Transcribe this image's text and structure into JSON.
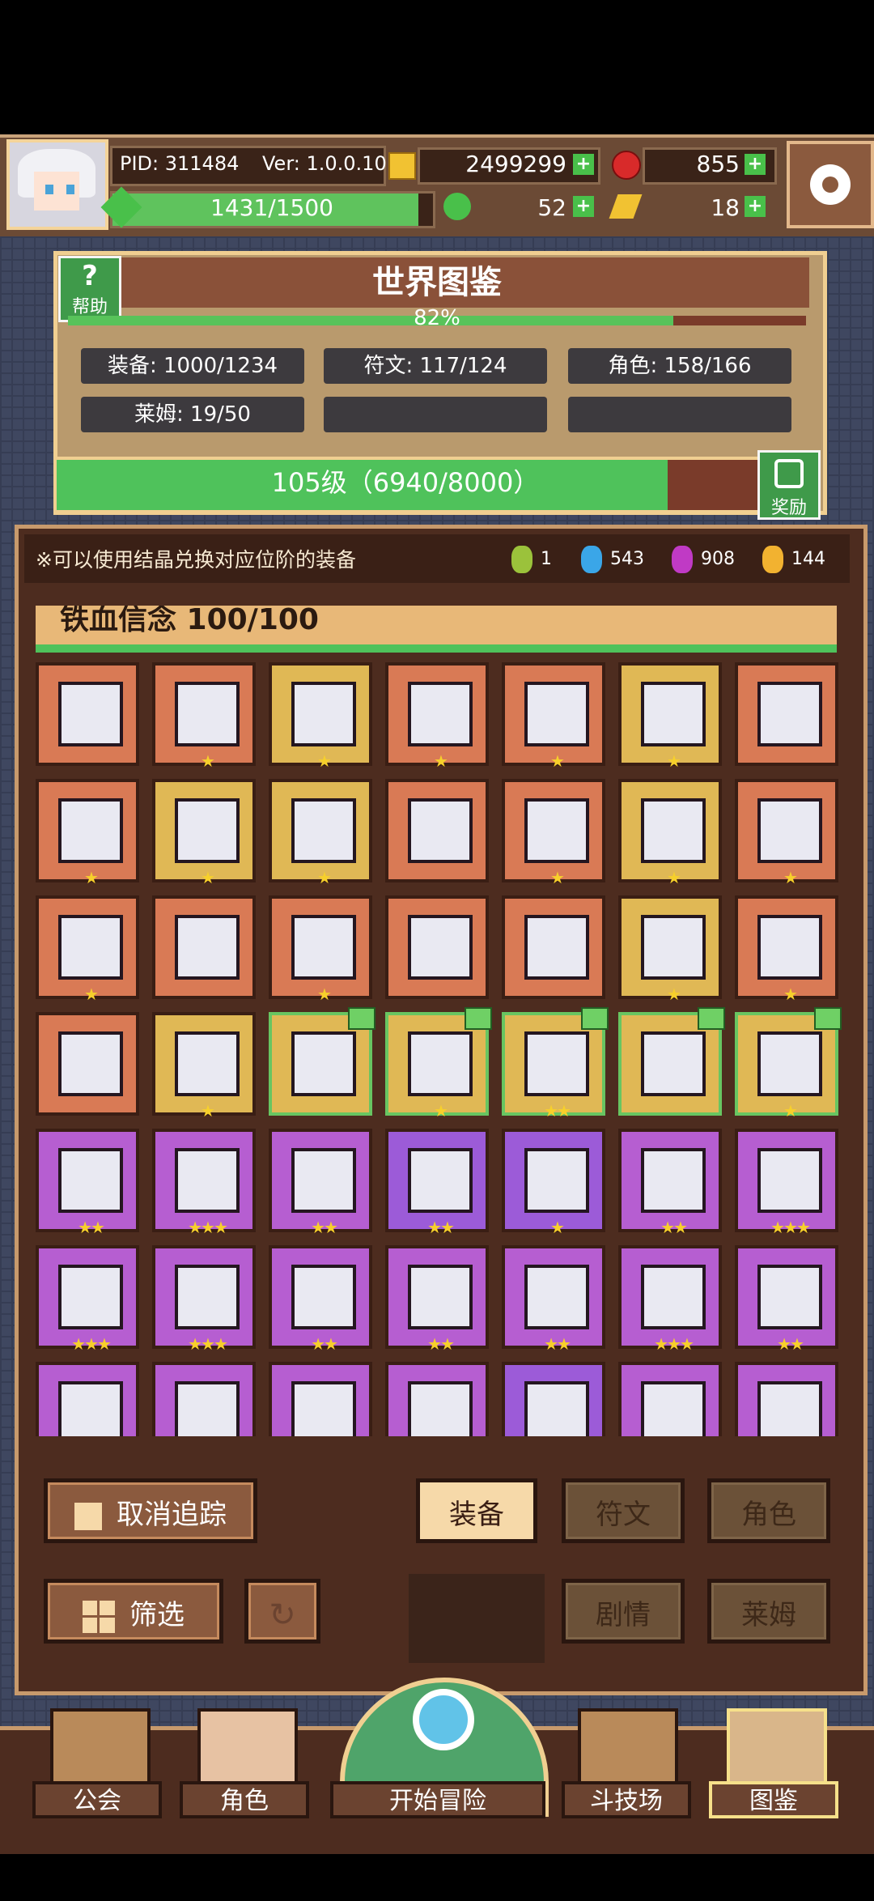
{
  "header": {
    "pid": "PID: 311484",
    "version": "Ver: 1.0.0.10",
    "gold": "2499299",
    "ruby": "855",
    "energy": "1431/1500",
    "energy_fraction": 0.954,
    "clover": "52",
    "ticket": "18"
  },
  "codex": {
    "title": "世界图鉴",
    "help_label": "帮助",
    "progress_text": "82%",
    "progress_fraction": 0.82,
    "stats": {
      "equipment": "装备: 1000/1234",
      "rune": "符文: 117/124",
      "character": "角色: 158/166",
      "slime": "莱姆: 19/50"
    },
    "level_text": "105级（6940/8000）",
    "level_fraction": 0.8675,
    "reward_label": "奖励"
  },
  "main": {
    "note": "※可以使用结晶兑换对应位阶的装备",
    "crystals": [
      {
        "color": "#9bc23b",
        "count": "1"
      },
      {
        "color": "#3aa6e8",
        "count": "543"
      },
      {
        "color": "#c03ac5",
        "count": "908"
      },
      {
        "color": "#f2b230",
        "count": "144"
      }
    ],
    "set_title": "铁血信念  100/100",
    "grid_rows": [
      [
        {
          "bg": "red",
          "stars": 0
        },
        {
          "bg": "red",
          "stars": 1
        },
        {
          "bg": "gold",
          "stars": 1
        },
        {
          "bg": "red",
          "stars": 1
        },
        {
          "bg": "red",
          "stars": 1
        },
        {
          "bg": "gold",
          "stars": 1
        },
        {
          "bg": "red",
          "stars": 0
        }
      ],
      [
        {
          "bg": "red",
          "stars": 1
        },
        {
          "bg": "gold",
          "stars": 1
        },
        {
          "bg": "gold",
          "stars": 1
        },
        {
          "bg": "red",
          "stars": 0
        },
        {
          "bg": "red",
          "stars": 1
        },
        {
          "bg": "gold",
          "stars": 1
        },
        {
          "bg": "red",
          "stars": 1
        }
      ],
      [
        {
          "bg": "red",
          "stars": 1
        },
        {
          "bg": "red",
          "stars": 0
        },
        {
          "bg": "red",
          "stars": 1
        },
        {
          "bg": "red",
          "stars": 0
        },
        {
          "bg": "red",
          "stars": 0
        },
        {
          "bg": "gold",
          "stars": 1
        },
        {
          "bg": "red",
          "stars": 1
        }
      ],
      [
        {
          "bg": "red",
          "stars": 0
        },
        {
          "bg": "gold",
          "stars": 1
        },
        {
          "bg": "gold",
          "stars": 0,
          "new": true
        },
        {
          "bg": "gold",
          "stars": 1,
          "new": true
        },
        {
          "bg": "gold",
          "stars": 2,
          "new": true
        },
        {
          "bg": "gold",
          "stars": 0,
          "new": true
        },
        {
          "bg": "gold",
          "stars": 1,
          "new": true
        }
      ],
      [
        {
          "bg": "purple",
          "stars": 2
        },
        {
          "bg": "purple",
          "stars": 3
        },
        {
          "bg": "purple",
          "stars": 2
        },
        {
          "bg": "violet",
          "stars": 2
        },
        {
          "bg": "violet",
          "stars": 1
        },
        {
          "bg": "purple",
          "stars": 2
        },
        {
          "bg": "purple",
          "stars": 3
        }
      ],
      [
        {
          "bg": "purple",
          "stars": 3
        },
        {
          "bg": "purple",
          "stars": 3
        },
        {
          "bg": "purple",
          "stars": 2
        },
        {
          "bg": "purple",
          "stars": 2
        },
        {
          "bg": "purple",
          "stars": 2
        },
        {
          "bg": "purple",
          "stars": 3
        },
        {
          "bg": "purple",
          "stars": 2
        }
      ],
      [
        {
          "bg": "purple",
          "stars": 0
        },
        {
          "bg": "purple",
          "stars": 0
        },
        {
          "bg": "purple",
          "stars": 0
        },
        {
          "bg": "purple",
          "stars": 0
        },
        {
          "bg": "violet",
          "stars": 0
        },
        {
          "bg": "purple",
          "stars": 0
        },
        {
          "bg": "purple",
          "stars": 0
        }
      ]
    ]
  },
  "controls": {
    "untrack": "取消追踪",
    "filter": "筛选",
    "tabs": {
      "equipment": "装备",
      "rune": "符文",
      "character": "角色",
      "story": "剧情",
      "slime": "莱姆"
    }
  },
  "nav": {
    "guild": "公会",
    "character": "角色",
    "adventure": "开始冒险",
    "arena": "斗技场",
    "codex": "图鉴"
  }
}
